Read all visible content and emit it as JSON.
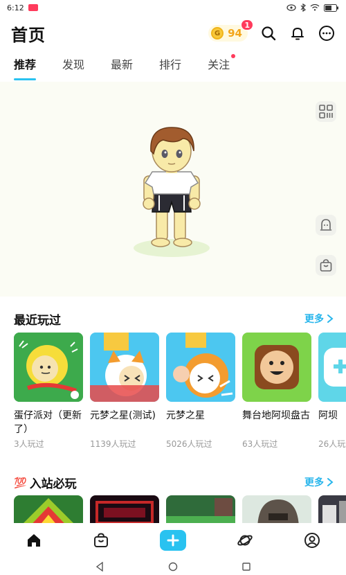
{
  "status": {
    "time": "6:12"
  },
  "header": {
    "title": "首页",
    "coins": "94",
    "coin_badge": "1"
  },
  "tabs": [
    {
      "label": "推荐"
    },
    {
      "label": "发现"
    },
    {
      "label": "最新"
    },
    {
      "label": "排行"
    },
    {
      "label": "关注"
    }
  ],
  "recent": {
    "title": "最近玩过",
    "more": "更多",
    "games": [
      {
        "name": "蛋仔派对（更新了）",
        "plays": "3人玩过"
      },
      {
        "name": "元梦之星(测试)",
        "plays": "1139人玩过"
      },
      {
        "name": "元梦之星",
        "plays": "5026人玩过"
      },
      {
        "name": "舞台地阿坝盘古",
        "plays": "63人玩过"
      },
      {
        "name": "阿坝",
        "plays": "26人玩过"
      }
    ]
  },
  "must_play": {
    "title": "入站必玩",
    "emoji": "💯",
    "more": "更多"
  },
  "colors": {
    "accent": "#29c2f0",
    "badge": "#ff3b5c",
    "coin": "#f3a61b"
  }
}
